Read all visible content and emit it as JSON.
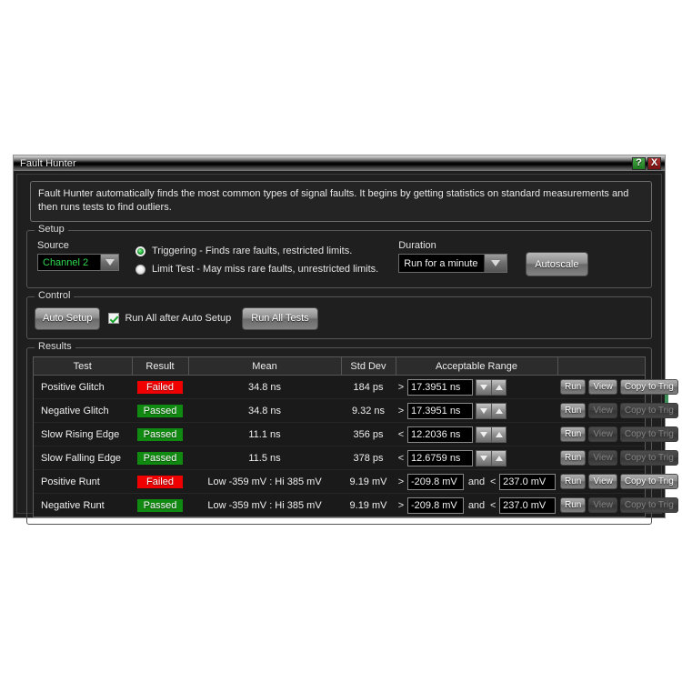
{
  "window": {
    "title": "Fault Hunter",
    "help_label": "?",
    "close_label": "X"
  },
  "description": "Fault Hunter automatically finds the most common types of signal faults. It begins by getting statistics on standard measurements and then runs tests to find outliers.",
  "setup": {
    "legend": "Setup",
    "source_label": "Source",
    "source_value": "Channel 2",
    "modes": [
      {
        "label": "Triggering - Finds rare faults, restricted limits.",
        "selected": true
      },
      {
        "label": "Limit Test - May miss rare faults, unrestricted limits.",
        "selected": false
      }
    ],
    "duration_label": "Duration",
    "duration_value": "Run for a minute",
    "autoscale_label": "Autoscale"
  },
  "control": {
    "legend": "Control",
    "auto_setup_label": "Auto Setup",
    "run_all_after_auto_setup_label": "Run All after Auto Setup",
    "run_all_after_auto_setup_checked": true,
    "run_all_tests_label": "Run All Tests"
  },
  "results": {
    "legend": "Results",
    "columns": [
      "Test",
      "Result",
      "Mean",
      "Std Dev",
      "Acceptable Range",
      ""
    ],
    "actions": {
      "run": "Run",
      "view": "View",
      "copy": "Copy to Trig"
    },
    "and_label": "and",
    "rows": [
      {
        "test": "Positive Glitch",
        "result": "Failed",
        "status": "failed",
        "mean": "34.8 ns",
        "std_dev": "184 ps",
        "range_type": "spinner",
        "cmp1": ">",
        "limit1": "17.3951 ns",
        "cmp2": "",
        "limit2": "",
        "actions_enabled": true
      },
      {
        "test": "Negative Glitch",
        "result": "Passed",
        "status": "passed",
        "mean": "34.8 ns",
        "std_dev": "9.32 ns",
        "range_type": "spinner",
        "cmp1": ">",
        "limit1": "17.3951 ns",
        "cmp2": "",
        "limit2": "",
        "actions_enabled": false
      },
      {
        "test": "Slow Rising Edge",
        "result": "Passed",
        "status": "passed",
        "mean": "11.1 ns",
        "std_dev": "356 ps",
        "range_type": "spinner",
        "cmp1": "<",
        "limit1": "12.2036 ns",
        "cmp2": "",
        "limit2": "",
        "actions_enabled": false
      },
      {
        "test": "Slow Falling Edge",
        "result": "Passed",
        "status": "passed",
        "mean": "11.5 ns",
        "std_dev": "378 ps",
        "range_type": "spinner",
        "cmp1": "<",
        "limit1": "12.6759 ns",
        "cmp2": "",
        "limit2": "",
        "actions_enabled": false
      },
      {
        "test": "Positive Runt",
        "result": "Failed",
        "status": "failed",
        "mean": "Low -359 mV : Hi 385 mV",
        "std_dev": "9.19 mV",
        "range_type": "dual",
        "cmp1": ">",
        "limit1": "-209.8 mV",
        "cmp2": "<",
        "limit2": "237.0 mV",
        "actions_enabled": true
      },
      {
        "test": "Negative Runt",
        "result": "Passed",
        "status": "passed",
        "mean": "Low -359 mV : Hi 385 mV",
        "std_dev": "9.19 mV",
        "range_type": "dual",
        "cmp1": ">",
        "limit1": "-209.8 mV",
        "cmp2": "<",
        "limit2": "237.0 mV",
        "actions_enabled": false
      }
    ]
  }
}
